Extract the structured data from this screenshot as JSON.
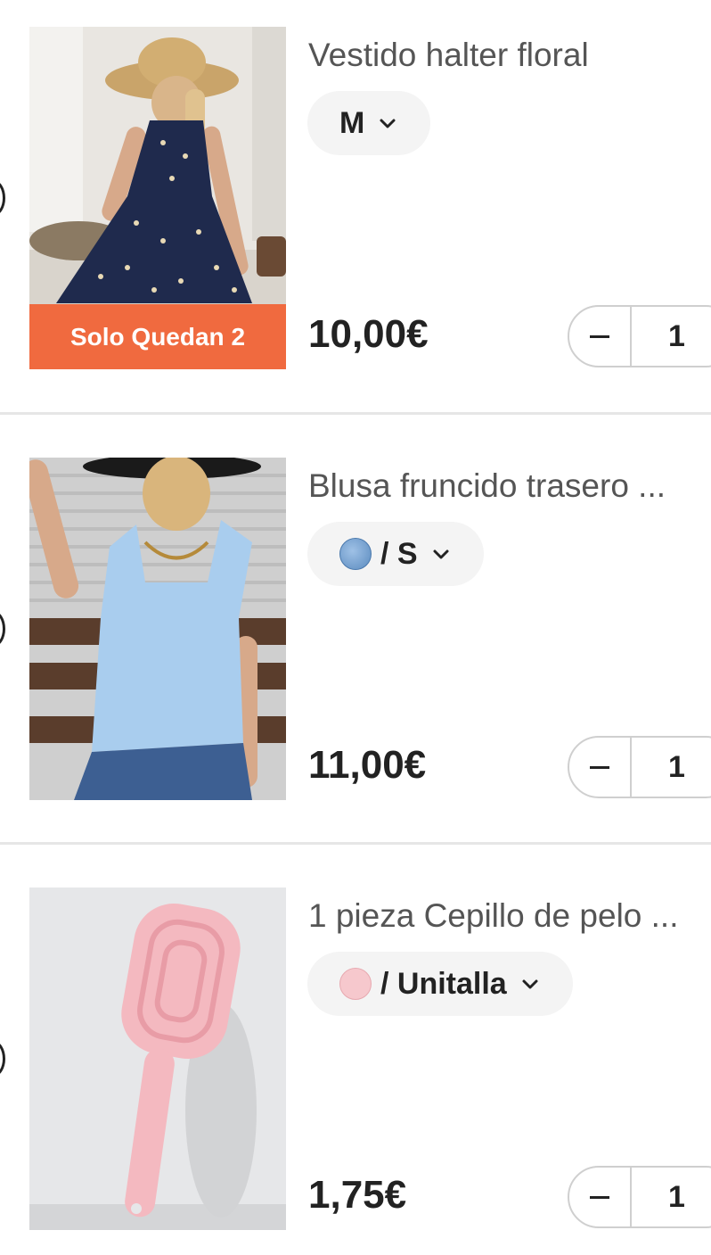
{
  "items": [
    {
      "title": "Vestido halter floral",
      "variant": "M",
      "stock_label": "Solo Quedan  2",
      "price": "10,00€",
      "quantity": "1",
      "swatch": null
    },
    {
      "title": "Blusa fruncido trasero ...",
      "variant": "/ S",
      "price": "11,00€",
      "quantity": "1",
      "swatch": "#7fa8d6"
    },
    {
      "title": "1 pieza Cepillo de pelo ...",
      "variant": "/ Unitalla",
      "price": "1,75€",
      "quantity": "1",
      "swatch": "#f6c8cd"
    }
  ],
  "colors": {
    "stock_banner": "#f06a3f",
    "variant_pill": "#f4f4f4",
    "divider": "#e6e6e6"
  },
  "icons": {
    "variant_dropdown": "chevron-down-icon",
    "decrease": "minus-icon"
  }
}
